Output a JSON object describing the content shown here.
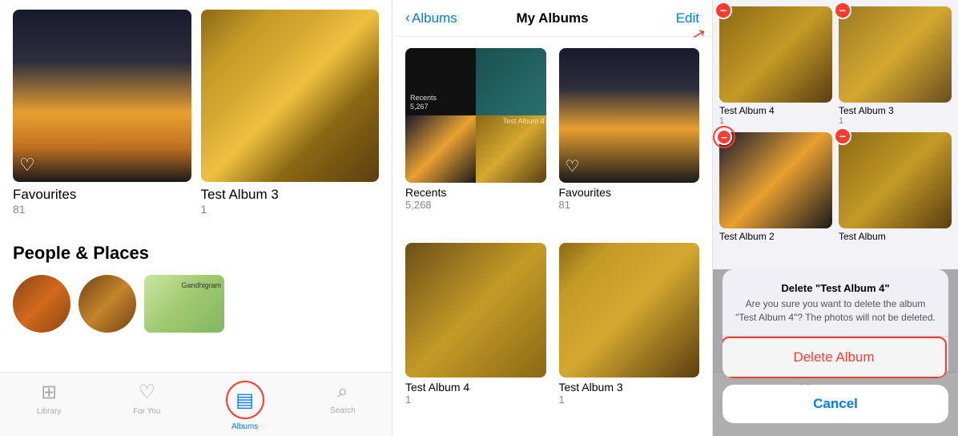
{
  "panel1": {
    "albums": [
      {
        "title": "Favourites",
        "count": "81"
      },
      {
        "title": "Test Album 3",
        "count": "1"
      }
    ],
    "section_people": "People & Places",
    "map_label": "Gandhigram"
  },
  "panel2": {
    "nav_back": "Albums",
    "nav_title": "My Albums",
    "nav_edit": "Edit",
    "albums": [
      {
        "name": "Recents",
        "count": "5,268"
      },
      {
        "name": "Favourites",
        "count": "81"
      },
      {
        "name": "Test Album 4",
        "count": "1"
      },
      {
        "name": "Test Album 3",
        "count": "1"
      }
    ]
  },
  "panel3": {
    "albums": [
      {
        "name": "Test Album 4",
        "count": "1"
      },
      {
        "name": "Test Album 3",
        "count": "1"
      },
      {
        "name": "Test Album 2",
        "count": ""
      },
      {
        "name": "Test Album",
        "count": ""
      }
    ],
    "tabs": [
      {
        "label": "Library",
        "active": false
      },
      {
        "label": "For You",
        "active": false
      },
      {
        "label": "Albums",
        "active": true
      },
      {
        "label": "Search",
        "active": false
      }
    ],
    "alert": {
      "title": "Delete \"Test Album 4\"",
      "message": "Are you sure you want to delete the album \"Test Album 4\"? The photos will not be deleted.",
      "delete_btn": "Delete Album",
      "cancel_btn": "Cancel"
    }
  },
  "tabs": [
    {
      "label": "Library",
      "active": false
    },
    {
      "label": "For You",
      "active": false
    },
    {
      "label": "Albums",
      "active": true
    },
    {
      "label": "Search",
      "active": false
    }
  ]
}
